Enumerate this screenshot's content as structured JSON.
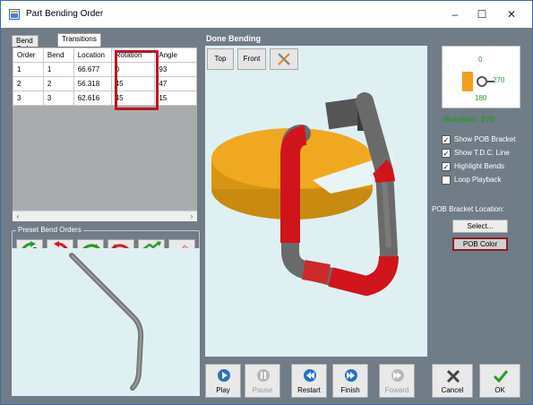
{
  "window": {
    "title": "Part Bending Order",
    "minimize_glyph": "–",
    "maximize_glyph": "☐",
    "close_glyph": "✕"
  },
  "tabs": [
    {
      "label": "Bend Order",
      "active": false
    },
    {
      "label": "Transitions",
      "active": true
    }
  ],
  "grid": {
    "columns": [
      "Order",
      "Bend",
      "Location",
      "Rotation",
      "Angle"
    ],
    "rows": [
      [
        "1",
        "1",
        "66.677",
        "0",
        "93"
      ],
      [
        "2",
        "2",
        "56.318",
        "45",
        "47"
      ],
      [
        "3",
        "3",
        "62.616",
        "45",
        "15"
      ]
    ],
    "highlight_color": "#c0141c"
  },
  "preset": {
    "label": "Preset Bend Orders",
    "buttons": [
      {
        "icon": "bar-chart-up-arrow-icon"
      },
      {
        "icon": "bar-chart-down-arrow-icon"
      },
      {
        "icon": "swap-arrows-green-red-icon"
      },
      {
        "icon": "swap-arrows-red-green-icon"
      },
      {
        "icon": "bar-chart-random-arrow-icon"
      },
      {
        "icon": "eraser-icon"
      }
    ]
  },
  "viewport": {
    "label": "Done Bending",
    "top_label": "Top",
    "front_label": "Front",
    "tool_icon": "wrench-screwdriver-icon"
  },
  "playback": [
    {
      "label": "Play",
      "icon": "play-icon",
      "enabled": true
    },
    {
      "label": "Pause",
      "icon": "pause-icon",
      "enabled": false
    },
    {
      "label": "Restart",
      "icon": "restart-icon",
      "enabled": true
    },
    {
      "label": "Finish",
      "icon": "finish-icon",
      "enabled": true
    },
    {
      "label": "Foward",
      "icon": "forward-icon",
      "enabled": false
    }
  ],
  "rotation_preview": {
    "top": "0",
    "right": "270",
    "bottom": "180",
    "status": "Rotation: 270",
    "status_color": "#2a9a2a",
    "bracket_color": "#f0a020"
  },
  "options": [
    {
      "label": "Show POB Bracket",
      "checked": true
    },
    {
      "label": "Show T.D.C. Line",
      "checked": true
    },
    {
      "label": "Highlight Bends",
      "checked": true
    },
    {
      "label": "Loop Playback",
      "checked": false
    }
  ],
  "pob": {
    "location_label": "POB Bracket Location:",
    "select_label": "Select...",
    "color_label": "POB Color"
  },
  "dialog": {
    "cancel_label": "Cancel",
    "ok_label": "OK"
  }
}
